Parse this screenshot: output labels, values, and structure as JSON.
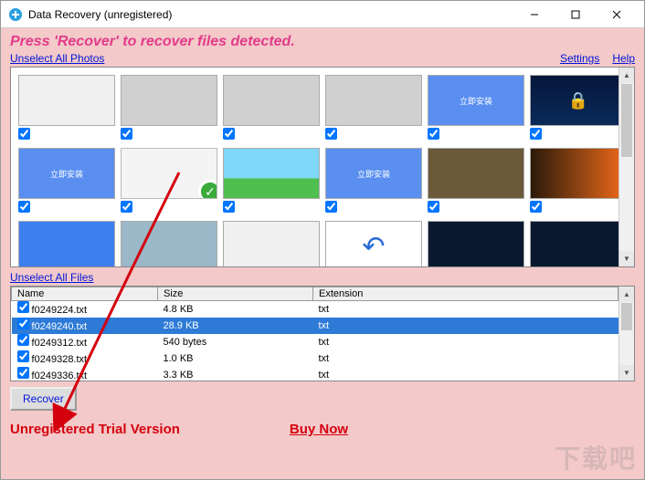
{
  "window": {
    "title": "Data Recovery (unregistered)"
  },
  "instruction": "Press 'Recover' to recover files detected.",
  "links": {
    "unselect_photos": "Unselect All Photos",
    "unselect_files": "Unselect All Files",
    "settings": "Settings",
    "help": "Help"
  },
  "photos": [
    {
      "icon": "window-thumb",
      "checked": true
    },
    {
      "icon": "blank",
      "checked": true
    },
    {
      "icon": "blank",
      "checked": true
    },
    {
      "icon": "blank",
      "checked": true
    },
    {
      "icon": "blue-button",
      "label": "立即安装",
      "checked": true
    },
    {
      "icon": "lock-matrix",
      "checked": true
    },
    {
      "icon": "blue-button",
      "label": "立即安装",
      "checked": true
    },
    {
      "icon": "app-window-check",
      "checked": true
    },
    {
      "icon": "landscape",
      "checked": true
    },
    {
      "icon": "blue-button",
      "label": "立即安装",
      "checked": true
    },
    {
      "icon": "person-photo",
      "checked": true
    },
    {
      "icon": "fire-photo",
      "checked": true
    },
    {
      "icon": "blue-panel",
      "checked": true
    },
    {
      "icon": "sky-photo",
      "checked": true
    },
    {
      "icon": "app-listing",
      "checked": true
    },
    {
      "icon": "back-arrow",
      "checked": true
    },
    {
      "icon": "dark-photo",
      "checked": true
    },
    {
      "icon": "dark-photo",
      "checked": true
    }
  ],
  "file_table": {
    "headers": {
      "name": "Name",
      "size": "Size",
      "ext": "Extension"
    },
    "rows": [
      {
        "name": "f0249224.txt",
        "size": "4.8 KB",
        "ext": "txt",
        "checked": true,
        "selected": false
      },
      {
        "name": "f0249240.txt",
        "size": "28.9 KB",
        "ext": "txt",
        "checked": true,
        "selected": true
      },
      {
        "name": "f0249312.txt",
        "size": "540 bytes",
        "ext": "txt",
        "checked": true,
        "selected": false
      },
      {
        "name": "f0249328.txt",
        "size": "1.0 KB",
        "ext": "txt",
        "checked": true,
        "selected": false
      },
      {
        "name": "f0249336.txt",
        "size": "3.3 KB",
        "ext": "txt",
        "checked": true,
        "selected": false
      }
    ]
  },
  "buttons": {
    "recover": "Recover"
  },
  "footer": {
    "trial": "Unregistered Trial Version",
    "buy": "Buy Now"
  },
  "watermark": "下载吧"
}
